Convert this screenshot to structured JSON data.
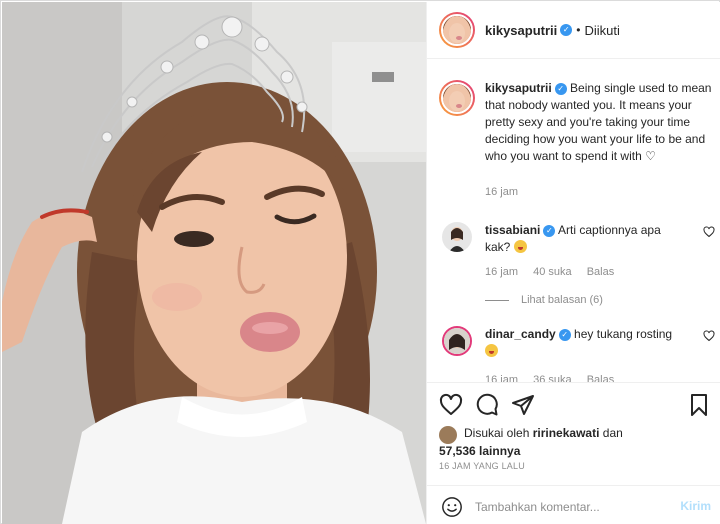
{
  "header": {
    "username": "kikysaputrii",
    "separator": "•",
    "follow_status": "Diikuti"
  },
  "caption": {
    "username": "kikysaputrii",
    "text": "Being single used to mean that nobody wanted you. It means your pretty sexy and you're taking your time deciding how you want your life to be and who you want to spend it with ♡",
    "time": "16 jam"
  },
  "comments": [
    {
      "username": "tissabiani",
      "text": "Arti captionnya apa kak?",
      "time": "16 jam",
      "likes": "40 suka",
      "reply_label": "Balas",
      "view_replies": "Lihat balasan (6)"
    },
    {
      "username": "dinar_candy",
      "text": "hey tukang rosting",
      "time": "16 jam",
      "likes": "36 suka",
      "reply_label": "Balas"
    }
  ],
  "likes": {
    "prefix": "Disukai oleh",
    "liker": "ririnekawati",
    "conj": "dan",
    "count": "57,536",
    "suffix": "lainnya"
  },
  "post_time": "16 JAM YANG LALU",
  "add_comment": {
    "placeholder": "Tambahkan komentar...",
    "send_label": "Kirim"
  },
  "colors": {
    "verified": "#3897f0",
    "send_disabled": "#b2dffc",
    "meta_text": "#8e8e8e"
  }
}
